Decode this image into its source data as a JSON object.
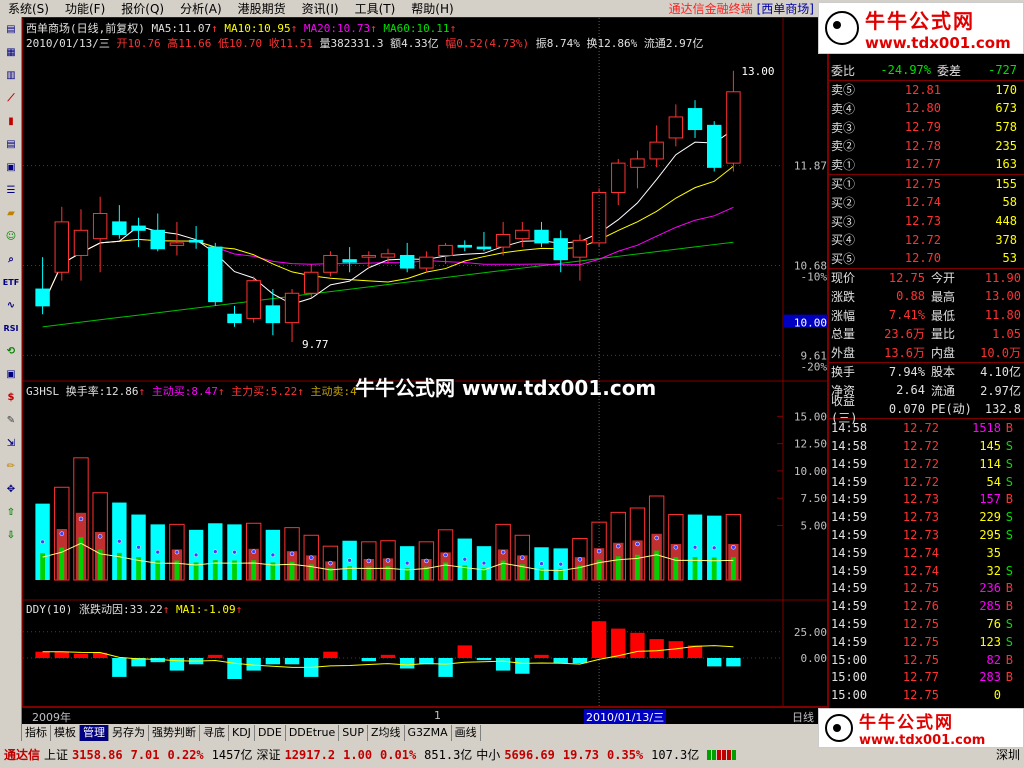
{
  "menu": {
    "items": [
      "系统(S)",
      "功能(F)",
      "报价(Q)",
      "分析(A)",
      "港股期货",
      "资讯(I)",
      "工具(T)",
      "帮助(H)"
    ],
    "title": "通达信金融终端",
    "title_stock": "[西单商场]"
  },
  "main_panel": {
    "line1": {
      "name": "西单商场",
      "period": "(日线,前复权)",
      "ma5": "MA5:11.07",
      "ma10": "MA10:10.95",
      "ma20": "MA20:10.73",
      "ma60": "MA60:10.11"
    },
    "line2": {
      "date": "2010/01/13/三",
      "open": "开10.76",
      "high": "高11.66",
      "low": "低10.70",
      "close": "收11.51",
      "vol": "量382331.3",
      "amount": "额4.33亿",
      "range": "幅0.52(4.73%)",
      "amp": "振8.74%",
      "turnover": "换12.86%",
      "float": "流通2.97亿"
    },
    "price_axis": [
      "11.87",
      "10.68",
      "-10%",
      "10.00",
      "9.61",
      "-20%"
    ],
    "high_label": "13.00",
    "low_label": "9.77"
  },
  "hsl_panel": {
    "title": "G3HSL",
    "turnover": "换手率:12.86",
    "active_buy": "主动买:8.47",
    "main_buy": "主力买:5.22",
    "active_sell": "主动卖:4",
    "axis": [
      "15.00",
      "12.50",
      "10.00",
      "7.50",
      "5.00"
    ]
  },
  "ddy_panel": {
    "title": "DDY(10)",
    "factor": "涨跌动因:33.22",
    "ma1": "MA1:-1.09",
    "axis": [
      "25.00",
      "0.00"
    ]
  },
  "date_axis": {
    "year": "2009年",
    "mark": "1",
    "cursor_date": "2010/01/13/三",
    "period": "日线"
  },
  "tabs": [
    "指标",
    "模板",
    "管理",
    "另存为",
    "强势判断",
    "寻底",
    "KDJ",
    "DDE",
    "DDEtrue",
    "SUP",
    "Z均线",
    "G3ZMA",
    "画线"
  ],
  "quote": {
    "top_partial": {
      "label": "委比",
      "value": "-24.97%",
      "label2": "委差",
      "value2": "-727"
    },
    "sells": [
      {
        "label": "卖⑤",
        "price": "12.81",
        "vol": "170"
      },
      {
        "label": "卖④",
        "price": "12.80",
        "vol": "673"
      },
      {
        "label": "卖③",
        "price": "12.79",
        "vol": "578"
      },
      {
        "label": "卖②",
        "price": "12.78",
        "vol": "235"
      },
      {
        "label": "卖①",
        "price": "12.77",
        "vol": "163"
      }
    ],
    "buys": [
      {
        "label": "买①",
        "price": "12.75",
        "vol": "155"
      },
      {
        "label": "买②",
        "price": "12.74",
        "vol": "58"
      },
      {
        "label": "买③",
        "price": "12.73",
        "vol": "448"
      },
      {
        "label": "买④",
        "price": "12.72",
        "vol": "378"
      },
      {
        "label": "买⑤",
        "price": "12.70",
        "vol": "53"
      }
    ],
    "stats": [
      {
        "l1": "现价",
        "v1": "12.75",
        "l2": "今开",
        "v2": "11.90"
      },
      {
        "l1": "涨跌",
        "v1": "0.88",
        "l2": "最高",
        "v2": "13.00"
      },
      {
        "l1": "涨幅",
        "v1": "7.41%",
        "l2": "最低",
        "v2": "11.80"
      },
      {
        "l1": "总量",
        "v1": "23.6万",
        "l2": "量比",
        "v2": "1.05"
      },
      {
        "l1": "外盘",
        "v1": "13.6万",
        "l2": "内盘",
        "v2": "10.0万"
      }
    ],
    "stats2": [
      {
        "l1": "换手",
        "v1": "7.94%",
        "l2": "股本",
        "v2": "4.10亿"
      },
      {
        "l1": "净资",
        "v1": "2.64",
        "l2": "流通",
        "v2": "2.97亿"
      },
      {
        "l1": "收益(三)",
        "v1": "0.070",
        "l2": "PE(动)",
        "v2": "132.8"
      }
    ],
    "ticks": [
      {
        "t": "14:58",
        "p": "12.72",
        "v": "1518",
        "s": "B"
      },
      {
        "t": "14:58",
        "p": "12.72",
        "v": "145",
        "s": "S"
      },
      {
        "t": "14:59",
        "p": "12.72",
        "v": "114",
        "s": "S"
      },
      {
        "t": "14:59",
        "p": "12.72",
        "v": "54",
        "s": "S"
      },
      {
        "t": "14:59",
        "p": "12.73",
        "v": "157",
        "s": "B"
      },
      {
        "t": "14:59",
        "p": "12.73",
        "v": "229",
        "s": "S"
      },
      {
        "t": "14:59",
        "p": "12.73",
        "v": "295",
        "s": "S"
      },
      {
        "t": "14:59",
        "p": "12.74",
        "v": "35",
        "s": ""
      },
      {
        "t": "14:59",
        "p": "12.74",
        "v": "32",
        "s": "S"
      },
      {
        "t": "14:59",
        "p": "12.75",
        "v": "236",
        "s": "B"
      },
      {
        "t": "14:59",
        "p": "12.76",
        "v": "285",
        "s": "B"
      },
      {
        "t": "14:59",
        "p": "12.75",
        "v": "76",
        "s": "S"
      },
      {
        "t": "14:59",
        "p": "12.75",
        "v": "123",
        "s": "S"
      },
      {
        "t": "15:00",
        "p": "12.75",
        "v": "82",
        "s": "B"
      },
      {
        "t": "15:00",
        "p": "12.77",
        "v": "283",
        "s": "B"
      },
      {
        "t": "15:00",
        "p": "12.75",
        "v": "0",
        "s": ""
      }
    ]
  },
  "status": {
    "brand": "通达信",
    "sh_label": "上证",
    "sh_index": "3158.86",
    "sh_chg": "7.01",
    "sh_pct": "0.22%",
    "sh_amt": "1457亿",
    "sz_label": "深证",
    "sz_index": "12917.2",
    "sz_chg": "1.00",
    "sz_pct": "0.01%",
    "sz_amt": "851.3亿",
    "zx_label": "中小",
    "zx_index": "5696.69",
    "zx_chg": "19.73",
    "zx_pct": "0.35%",
    "zx_amt": "107.3亿",
    "right": "深圳"
  },
  "watermark": {
    "brand": "牛牛公式网",
    "url": "www.tdx001.com",
    "center": "牛牛公式网 www.tdx001.com"
  },
  "colors": {
    "up": "#ff3232",
    "down": "#00ffff",
    "ma5": "#ffffff",
    "ma10": "#ffff00",
    "ma20": "#ff00ff",
    "ma60": "#00c000"
  },
  "chart_data": {
    "type": "candlestick",
    "candles": [
      [
        10.4,
        10.78,
        10.1,
        10.2
      ],
      [
        10.6,
        11.38,
        10.5,
        11.2
      ],
      [
        10.8,
        11.35,
        10.5,
        11.1
      ],
      [
        11.0,
        11.5,
        10.6,
        11.3
      ],
      [
        11.2,
        11.4,
        11.0,
        11.05
      ],
      [
        11.15,
        11.25,
        10.9,
        11.1
      ],
      [
        11.1,
        11.3,
        10.85,
        10.88
      ],
      [
        10.92,
        11.2,
        10.8,
        10.95
      ],
      [
        10.98,
        11.15,
        10.88,
        10.96
      ],
      [
        10.9,
        10.95,
        10.2,
        10.25
      ],
      [
        10.1,
        10.2,
        9.95,
        10.0
      ],
      [
        10.05,
        10.55,
        10.0,
        10.5
      ],
      [
        10.2,
        10.4,
        9.85,
        10.0
      ],
      [
        10.0,
        10.4,
        9.77,
        10.35
      ],
      [
        10.35,
        10.7,
        10.3,
        10.6
      ],
      [
        10.6,
        10.85,
        10.55,
        10.8
      ],
      [
        10.75,
        10.9,
        10.6,
        10.72
      ],
      [
        10.78,
        10.85,
        10.65,
        10.8
      ],
      [
        10.78,
        10.88,
        10.7,
        10.82
      ],
      [
        10.8,
        10.95,
        10.6,
        10.65
      ],
      [
        10.65,
        10.85,
        10.6,
        10.78
      ],
      [
        10.8,
        10.95,
        10.7,
        10.92
      ],
      [
        10.92,
        10.98,
        10.85,
        10.9
      ],
      [
        10.9,
        11.08,
        10.85,
        10.88
      ],
      [
        10.9,
        11.2,
        10.8,
        11.05
      ],
      [
        11.0,
        11.2,
        10.9,
        11.1
      ],
      [
        11.1,
        11.2,
        10.9,
        10.95
      ],
      [
        11.0,
        11.1,
        10.6,
        10.75
      ],
      [
        10.78,
        11.05,
        10.5,
        10.98
      ],
      [
        10.95,
        11.6,
        10.9,
        11.55
      ],
      [
        11.55,
        11.95,
        11.4,
        11.9
      ],
      [
        11.85,
        12.05,
        11.6,
        11.95
      ],
      [
        11.95,
        12.35,
        11.85,
        12.15
      ],
      [
        12.2,
        12.6,
        12.1,
        12.45
      ],
      [
        12.55,
        12.65,
        12.2,
        12.3
      ],
      [
        12.35,
        12.4,
        11.8,
        11.85
      ],
      [
        11.9,
        13.0,
        11.8,
        12.75
      ]
    ],
    "hsl": [
      7.0,
      8.5,
      11.2,
      8.0,
      7.1,
      6.0,
      5.1,
      5.1,
      4.6,
      5.2,
      5.1,
      5.2,
      4.6,
      4.8,
      4.1,
      3.1,
      3.6,
      3.5,
      3.6,
      3.1,
      3.5,
      4.6,
      3.8,
      3.1,
      5.1,
      4.1,
      3.0,
      2.9,
      3.8,
      5.3,
      6.2,
      6.6,
      7.7,
      6.0,
      6.0,
      5.9,
      6.0
    ],
    "ddy": [
      6,
      6,
      4,
      5,
      -18,
      -8,
      -4,
      -12,
      -6,
      3,
      -20,
      -12,
      -6,
      -6,
      -18,
      6,
      0,
      -3,
      3,
      -10,
      -6,
      -18,
      12,
      -2,
      -12,
      -15,
      3,
      -5,
      -5,
      35,
      28,
      24,
      18,
      16,
      12,
      -8,
      -8
    ]
  }
}
